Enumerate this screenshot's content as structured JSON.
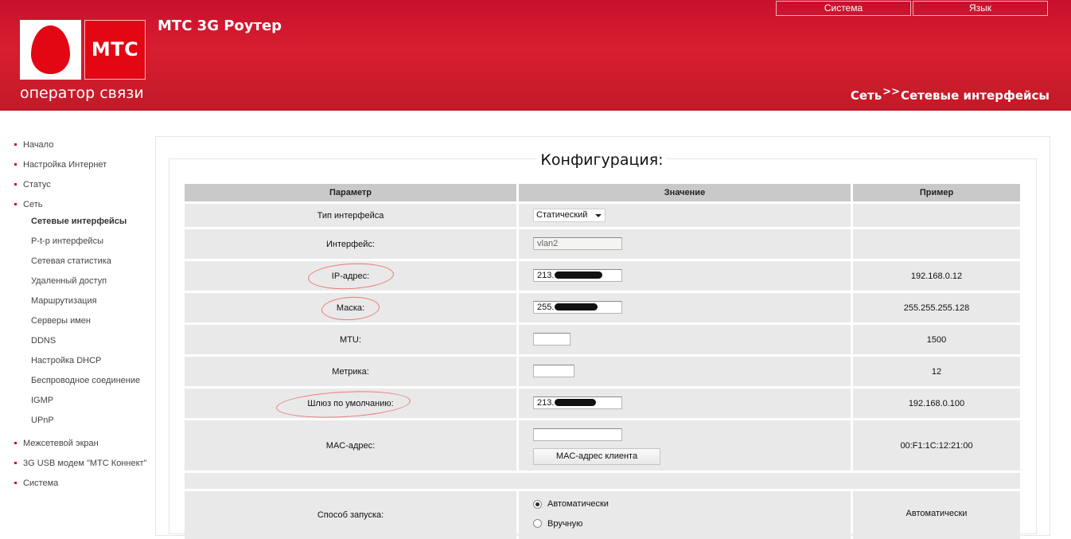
{
  "header": {
    "logo_text": "МТС",
    "tagline": "оператор связи",
    "app_title": "МТС 3G Роутер",
    "top_buttons": {
      "system": "Система",
      "language": "Язык"
    },
    "breadcrumb": {
      "section": "Сеть",
      "separator": ">>",
      "page": "Сетевые интерфейсы"
    }
  },
  "sidebar": {
    "items": [
      {
        "label": "Начало"
      },
      {
        "label": "Настройка Интернет"
      },
      {
        "label": "Статус"
      },
      {
        "label": "Сеть"
      }
    ],
    "network_subitems": [
      {
        "label": "Сетевые интерфейсы",
        "active": true
      },
      {
        "label": "P-t-p интерфейсы"
      },
      {
        "label": "Сетевая статистика"
      },
      {
        "label": "Удаленный доступ"
      },
      {
        "label": "Маршрутизация"
      },
      {
        "label": "Серверы имен"
      },
      {
        "label": "DDNS"
      },
      {
        "label": "Настройка DHCP"
      },
      {
        "label": "Беспроводное соединение"
      },
      {
        "label": "IGMP"
      },
      {
        "label": "UPnP"
      }
    ],
    "bottom_items": [
      {
        "label": "Межсетевой экран"
      },
      {
        "label": "3G USB модем \"МТС Коннект\""
      },
      {
        "label": "Система"
      }
    ]
  },
  "config": {
    "title": "Конфигурация:",
    "headers": {
      "param": "Параметр",
      "value": "Значение",
      "example": "Пример"
    },
    "rows": {
      "interface_type": {
        "label": "Тип интерфейса",
        "value": "Статический",
        "example": ""
      },
      "interface": {
        "label": "Интерфейс:",
        "value": "vlan2",
        "example": ""
      },
      "ip": {
        "label": "IP-адрес:",
        "value": "213.",
        "example": "192.168.0.12"
      },
      "mask": {
        "label": "Маска:",
        "value": "255.",
        "example": "255.255.255.128"
      },
      "mtu": {
        "label": "MTU:",
        "value": "",
        "example": "1500"
      },
      "metric": {
        "label": "Метрика:",
        "value": "",
        "example": "12"
      },
      "gateway": {
        "label": "Шлюз по умолчанию:",
        "value": "213.",
        "example": "192.168.0.100"
      },
      "mac": {
        "label": "MAC-адрес:",
        "value": "",
        "button": "MAC-адрес клиента",
        "example": "00:F1:1C:12:21:00"
      },
      "startup": {
        "label": "Способ запуска:",
        "option_auto": "Автоматически",
        "option_manual": "Вручную",
        "selected": "Автоматически",
        "example": "Автоматически"
      }
    }
  },
  "colors": {
    "brand_red": "#c8102e",
    "header_cell": "#c9c9c9",
    "row_cell": "#e9e9e9",
    "annotation": "#e77777"
  }
}
